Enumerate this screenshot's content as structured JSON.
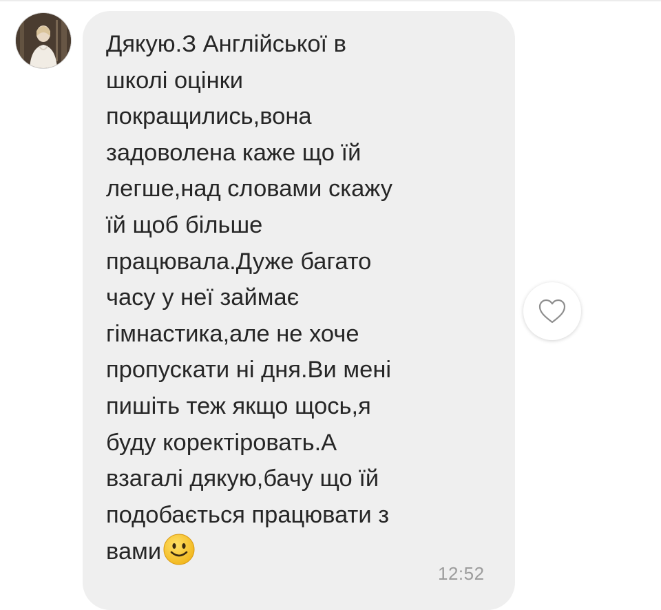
{
  "message": {
    "text": "Дякую.З Англійської в\nшколі оцінки\nпокращились,вона\nзадоволена каже що їй\nлегше,над словами скажу\nїй щоб більше\nпрацювала.Дуже багато\nчасу у неї займає\nгімнастика,але не хоче\nпропускати ні дня.Ви мені\nпишіть теж якщо щось,я\nбуду коректіровать.А\nвзагалі дякую,бачу  що їй\nподобається працювати з\nвами",
    "emoji": "slightly-smiling-face-icon",
    "time": "12:52"
  },
  "colors": {
    "bubble": "#efefef",
    "text": "#262626",
    "timestamp": "#9c9c9c",
    "emoji": "#f7c531"
  }
}
